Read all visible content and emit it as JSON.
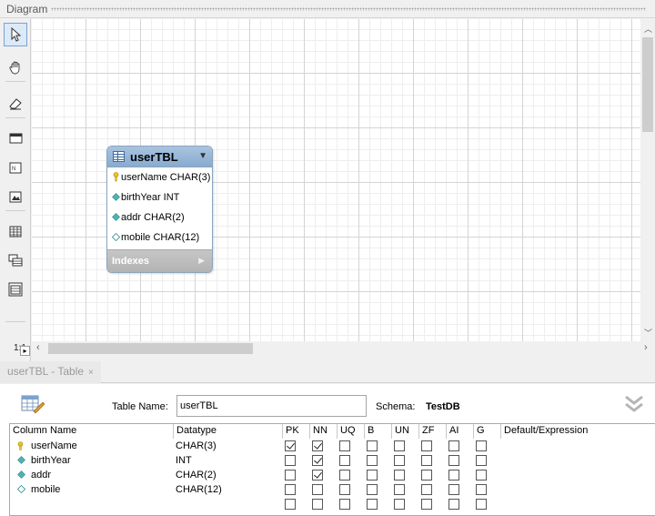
{
  "diagram": {
    "title": "Diagram",
    "zoom_label": "1:1"
  },
  "entity": {
    "name": "userTBL",
    "columns": [
      {
        "label": "userName CHAR(3)",
        "icon": "primary-key-icon"
      },
      {
        "label": "birthYear INT",
        "icon": "not-null-column-icon"
      },
      {
        "label": "addr CHAR(2)",
        "icon": "not-null-column-icon"
      },
      {
        "label": "mobile CHAR(12)",
        "icon": "nullable-column-icon"
      }
    ],
    "indexes_label": "Indexes"
  },
  "tab": {
    "label": "userTBL - Table",
    "close": "×"
  },
  "editor": {
    "table_name_label": "Table Name:",
    "table_name_value": "userTBL",
    "schema_label": "Schema:",
    "schema_value": "TestDB"
  },
  "grid": {
    "headers": [
      "Column Name",
      "Datatype",
      "PK",
      "NN",
      "UQ",
      "B",
      "UN",
      "ZF",
      "AI",
      "G",
      "Default/Expression"
    ],
    "rows": [
      {
        "name": "userName",
        "type": "CHAR(3)",
        "icon": "primary-key-icon",
        "flags": [
          true,
          true,
          false,
          false,
          false,
          false,
          false,
          false
        ]
      },
      {
        "name": "birthYear",
        "type": "INT",
        "icon": "not-null-column-icon",
        "flags": [
          false,
          true,
          false,
          false,
          false,
          false,
          false,
          false
        ]
      },
      {
        "name": "addr",
        "type": "CHAR(2)",
        "icon": "not-null-column-icon",
        "flags": [
          false,
          true,
          false,
          false,
          false,
          false,
          false,
          false
        ]
      },
      {
        "name": "mobile",
        "type": "CHAR(12)",
        "icon": "nullable-column-icon",
        "flags": [
          false,
          false,
          false,
          false,
          false,
          false,
          false,
          false
        ]
      },
      {
        "name": "",
        "type": "",
        "icon": "",
        "flags": [
          false,
          false,
          false,
          false,
          false,
          false,
          false,
          false
        ]
      }
    ]
  },
  "colors": {
    "entity_header": "#9bbad9",
    "key_icon": "#e8c229",
    "column_icon": "#4fb3b3",
    "canvas_bg": "#ffffff"
  }
}
